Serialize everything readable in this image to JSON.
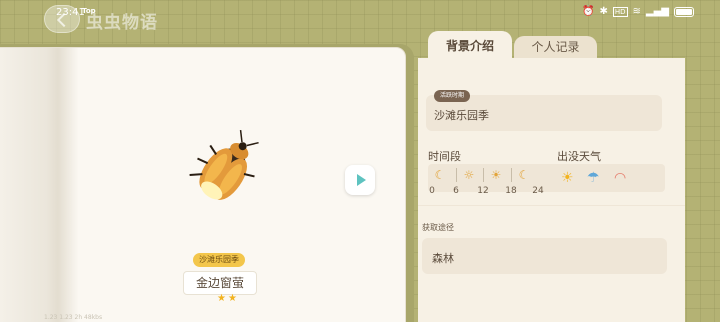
{
  "status_bar": {
    "time": "23:41",
    "carrier": "Top",
    "icons": [
      "alarm-icon",
      "bluetooth-icon",
      "hd-icon",
      "wifi-icon",
      "signal-icon",
      "battery-icon"
    ]
  },
  "header": {
    "app_title": "虫虫物语"
  },
  "insect_card": {
    "name": "金边窗萤",
    "season_tag": "沙滩乐园季",
    "stars": "★★",
    "footer_text": "1.23  1.23  2h 48kbs"
  },
  "tabs": [
    {
      "label": "背景介绍",
      "active": true
    },
    {
      "label": "个人记录",
      "active": false
    }
  ],
  "details": {
    "active_period_label": "活跃时期",
    "active_period_value": "沙滩乐园季",
    "time_period_title": "时间段",
    "weather_title": "出没天气",
    "time_icons": [
      "moon-icon",
      "sunrise-icon",
      "sun-icon",
      "moon-icon"
    ],
    "time_ticks": [
      "0",
      "6",
      "12",
      "18",
      "24"
    ],
    "weather_icons": [
      "sunny-icon",
      "rain-icon",
      "rainbow-icon"
    ],
    "obtain_label": "获取途径",
    "obtain_value": "森林"
  },
  "colors": {
    "background": "#b4b274",
    "panel": "#f7f1e5",
    "accent_teal": "#5ec3c0",
    "tag_yellow": "#f3c64b"
  }
}
